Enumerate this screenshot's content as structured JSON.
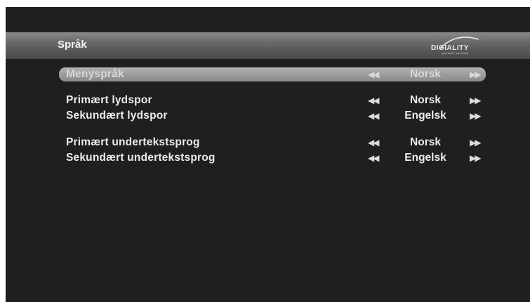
{
  "header": {
    "title": "Språk",
    "logo_text": "DIGIALITY",
    "logo_tagline": "your world · your choice"
  },
  "settings": [
    {
      "label": "Menyspråk",
      "value": "Norsk",
      "selected": true
    },
    {
      "label": "Primært lydspor",
      "value": "Norsk",
      "selected": false
    },
    {
      "label": "Sekundært lydspor",
      "value": "Engelsk",
      "selected": false
    },
    {
      "label": "Primært undertekstsprog",
      "value": "Norsk",
      "selected": false
    },
    {
      "label": "Sekundært undertekstsprog",
      "value": "Engelsk",
      "selected": false
    }
  ],
  "icons": {
    "prev": "skip-previous-icon",
    "next": "skip-next-icon"
  },
  "colors": {
    "background": "#1f1f1f",
    "header_bar": "#6b6b6b",
    "selection": "#9c9c9c",
    "text": "#ececec"
  }
}
